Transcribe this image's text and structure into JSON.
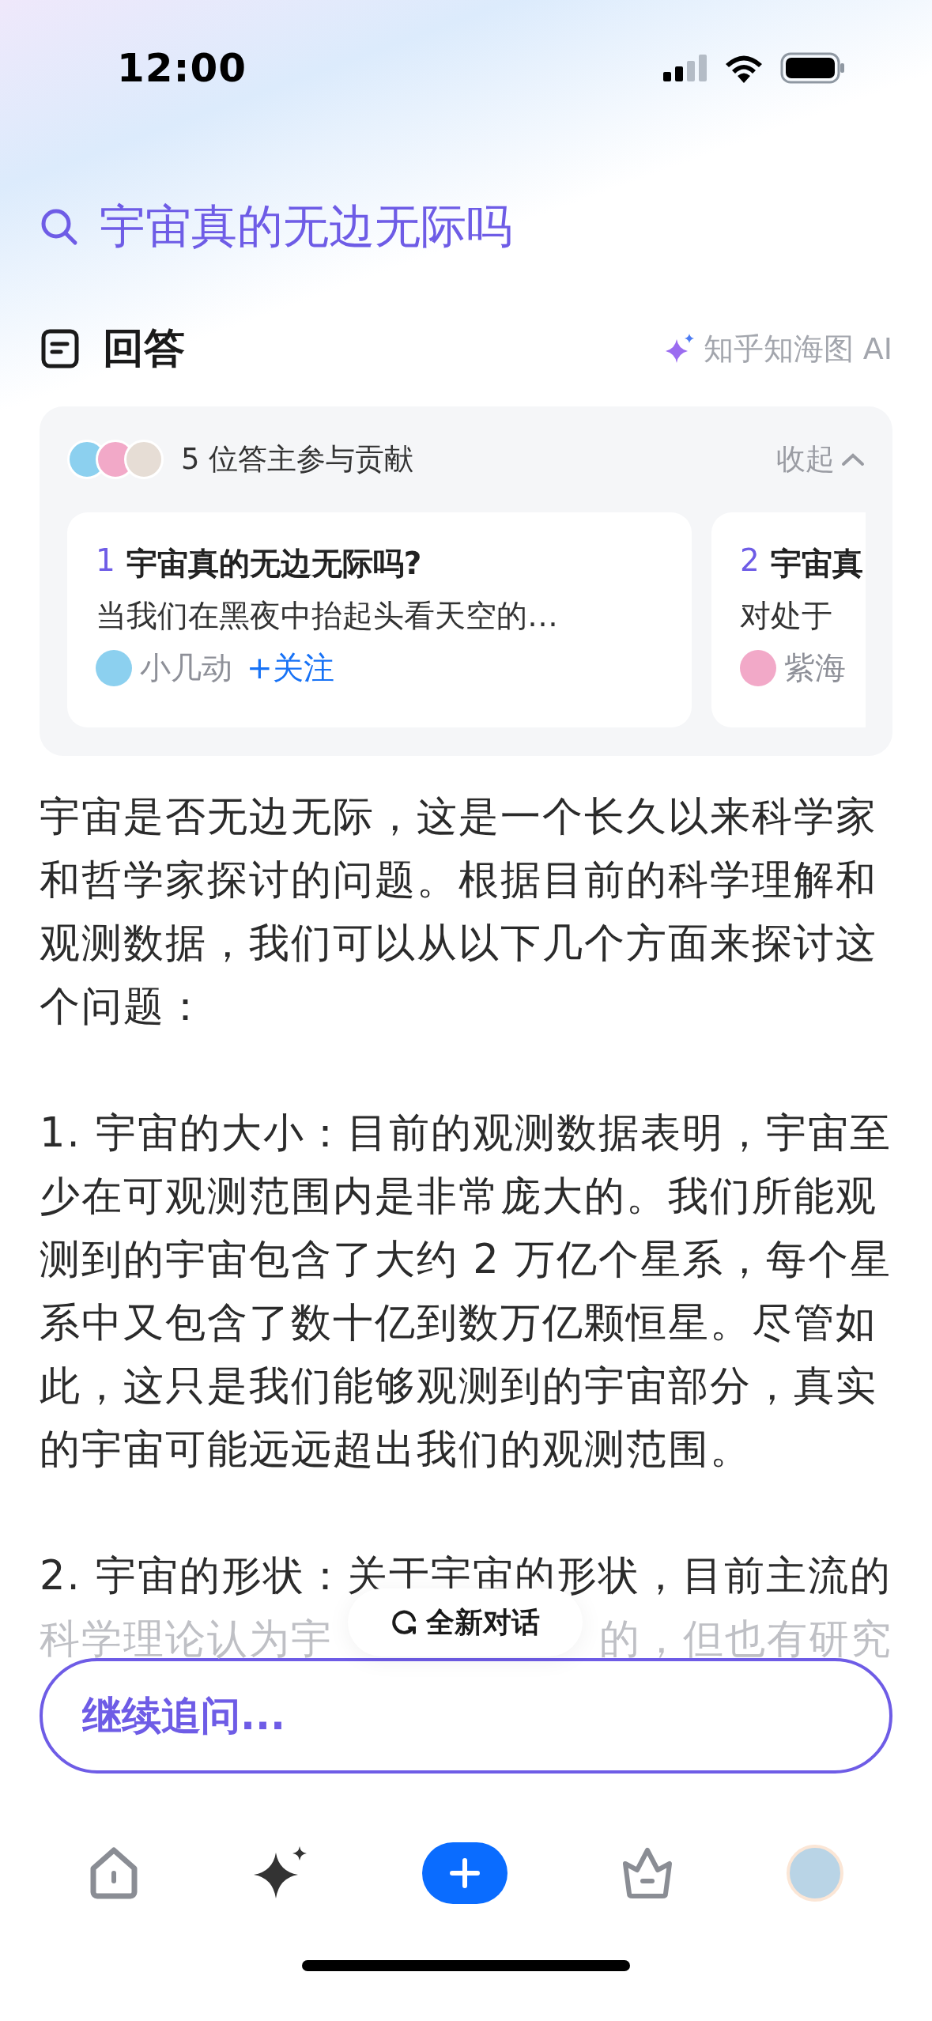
{
  "status_bar": {
    "time": "12:00"
  },
  "query": "宇宙真的无边无际吗",
  "section": {
    "title": "回答",
    "source": "知乎知海图 AI"
  },
  "contributors": {
    "summary": "5 位答主参与贡献",
    "collapse": "收起"
  },
  "sources": [
    {
      "index": "1",
      "title": "宇宙真的无边无际吗?",
      "excerpt": "当我们在黑夜中抬起头看天空的…",
      "author": "小几动",
      "follow": "+关注"
    },
    {
      "index": "2",
      "title": "宇宙真",
      "excerpt": "对处于",
      "author": "紫海"
    }
  ],
  "answer": {
    "paragraphs": [
      "宇宙是否无边无际，这是一个长久以来科学家和哲学家探讨的问题。根据目前的科学理解和观测数据，我们可以从以下几个方面来探讨这个问题：",
      "1. 宇宙的大小：目前的观测数据表明，宇宙至少在可观测范围内是非常庞大的。我们所能观测到的宇宙包含了大约 2 万亿个星系，每个星系中又包含了数十亿到数万亿颗恒星。尽管如此，这只是我们能够观测到的宇宙部分，真实的宇宙可能远远超出我们的观测范围。",
      "2. 宇宙的形状：关于宇宙的形状，目前主流的"
    ],
    "faded": [
      "科学理论认为宇",
      "的，但也有研究"
    ]
  },
  "new_chat": "全新对话",
  "input": {
    "placeholder": "继续追问..."
  },
  "tab_bar": [
    {
      "kind": "home"
    },
    {
      "kind": "sparkle"
    },
    {
      "kind": "plus"
    },
    {
      "kind": "crown"
    },
    {
      "kind": "avatar"
    }
  ]
}
